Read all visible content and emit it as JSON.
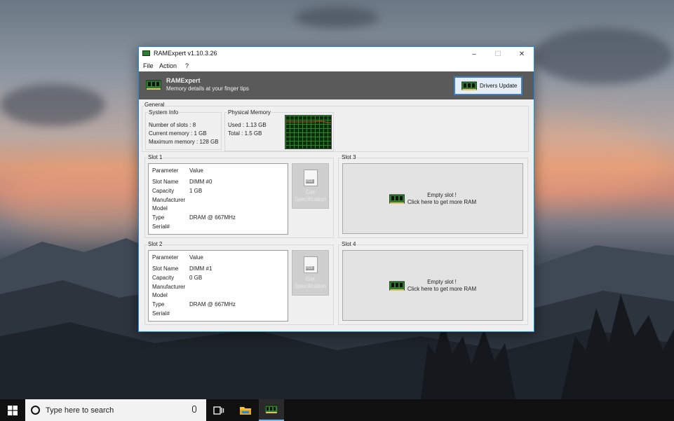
{
  "window": {
    "title": "RAMExpert v1.10.3.26",
    "controls": {
      "minimize": "–",
      "maximize": "☐",
      "close": "✕"
    }
  },
  "menu": [
    "File",
    "Action",
    "?"
  ],
  "banner": {
    "app_name": "RAMExpert",
    "tagline": "Memory details at your finger tips",
    "drivers_button": "Drivers Update"
  },
  "general": {
    "label": "General",
    "system_info": {
      "label": "System Info",
      "lines": [
        "Number of slots : 8",
        "Current memory : 1 GB",
        "Maximum memory : 128 GB"
      ]
    },
    "physical_memory": {
      "label": "Physical Memory",
      "lines": [
        "Used : 1.13 GB",
        "Total : 1.5 GB"
      ]
    }
  },
  "slots": [
    {
      "label": "Slot 1",
      "header": [
        "Parameter",
        "Value"
      ],
      "rows": [
        [
          "Slot Name",
          "DIMM #0"
        ],
        [
          "Capacity",
          "1 GB"
        ],
        [
          "Manufacturer",
          ""
        ],
        [
          "Model",
          ""
        ],
        [
          "Type",
          "DRAM @ 667MHz"
        ],
        [
          "Serial#",
          ""
        ]
      ],
      "spec_button": [
        "Get",
        "Specification"
      ],
      "pdf_tag": "PDF"
    },
    {
      "label": "Slot 2",
      "header": [
        "Parameter",
        "Value"
      ],
      "rows": [
        [
          "Slot Name",
          "DIMM #1"
        ],
        [
          "Capacity",
          "0 GB"
        ],
        [
          "Manufacturer",
          ""
        ],
        [
          "Model",
          ""
        ],
        [
          "Type",
          "DRAM @ 667MHz"
        ],
        [
          "Serial#",
          ""
        ]
      ],
      "spec_button": [
        "Get",
        "Specification"
      ],
      "pdf_tag": "PDF"
    }
  ],
  "empty_slots": [
    {
      "label": "Slot 3",
      "line1": "Empty slot !",
      "line2": "Click here to get more RAM"
    },
    {
      "label": "Slot 4",
      "line1": "Empty slot !",
      "line2": "Click here to get more RAM"
    }
  ],
  "taskbar": {
    "search_placeholder": "Type here to search"
  },
  "colors": {
    "accent": "#1e88e5",
    "banner": "#5a5a5a",
    "ram_green": "#2e7d32",
    "graph_bg": "#0b2d0b",
    "graph_line": "#d84315"
  }
}
